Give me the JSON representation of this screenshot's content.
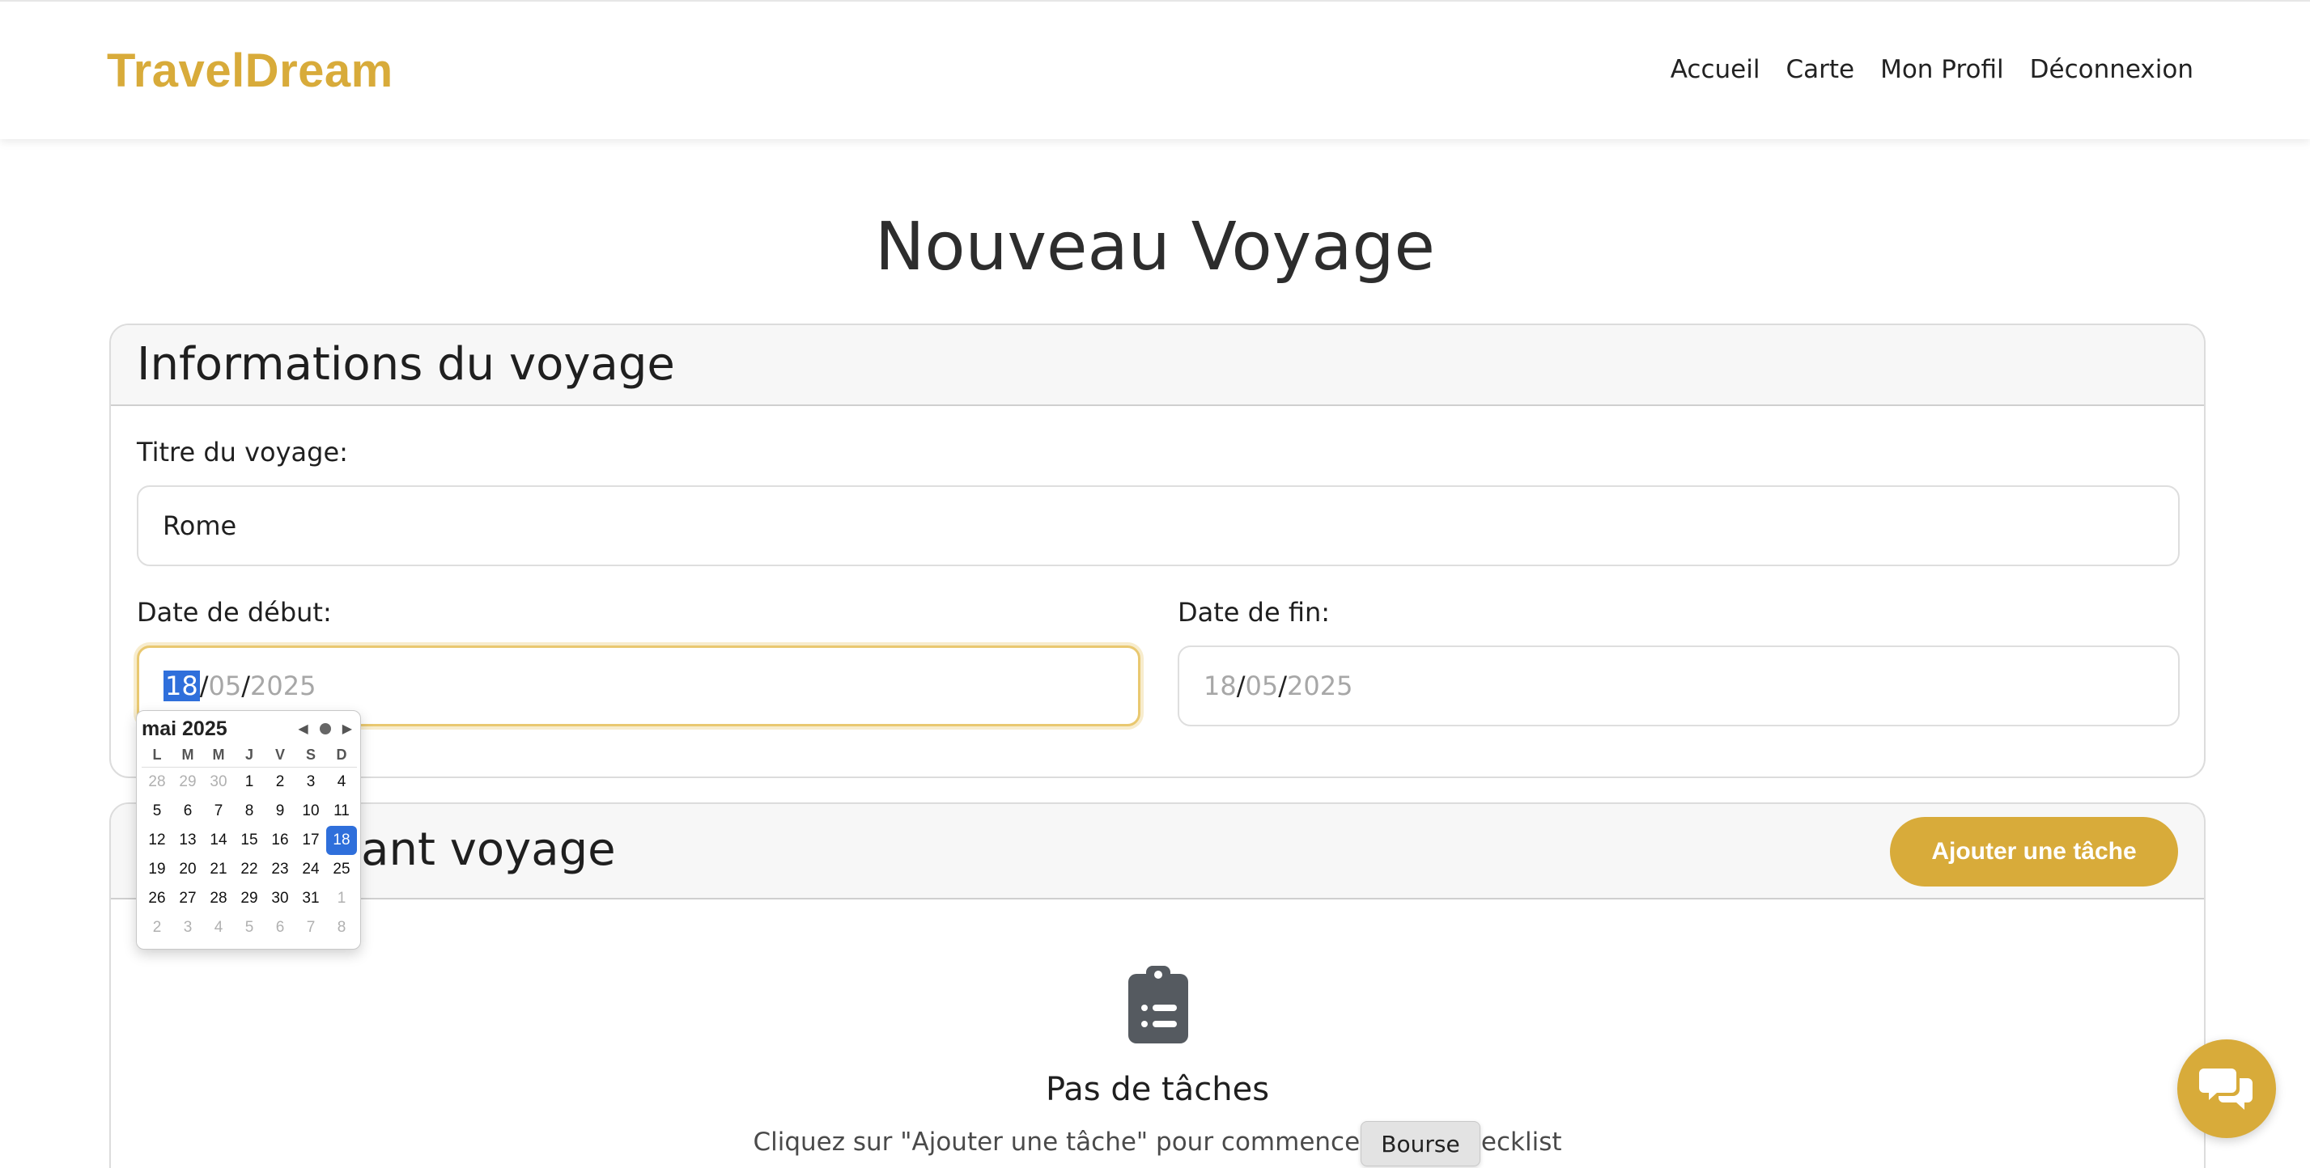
{
  "nav": {
    "brand": "TravelDream",
    "links": [
      "Accueil",
      "Carte",
      "Mon Profil",
      "Déconnexion"
    ]
  },
  "page": {
    "title": "Nouveau Voyage"
  },
  "info_card": {
    "title": "Informations du voyage",
    "trip_title_label": "Titre du voyage:",
    "trip_title_value": "Rome",
    "start_label": "Date de début:",
    "start_date": {
      "day": "18",
      "month": "05",
      "year": "2025"
    },
    "end_label": "Date de fin:",
    "end_date": {
      "day": "18",
      "month": "05",
      "year": "2025"
    }
  },
  "tasks_card": {
    "title": "Tâches avant voyage",
    "add_button": "Ajouter une tâche",
    "empty_title": "Pas de tâches",
    "empty_desc": "Cliquez sur \"Ajouter une tâche\" pour commencer votre checklist"
  },
  "calendar": {
    "month_label": "mai 2025",
    "weekdays": [
      "L",
      "M",
      "M",
      "J",
      "V",
      "S",
      "D"
    ],
    "days": [
      {
        "d": "28",
        "m": true
      },
      {
        "d": "29",
        "m": true
      },
      {
        "d": "30",
        "m": true
      },
      {
        "d": "1"
      },
      {
        "d": "2"
      },
      {
        "d": "3"
      },
      {
        "d": "4"
      },
      {
        "d": "5"
      },
      {
        "d": "6"
      },
      {
        "d": "7"
      },
      {
        "d": "8"
      },
      {
        "d": "9"
      },
      {
        "d": "10"
      },
      {
        "d": "11"
      },
      {
        "d": "12"
      },
      {
        "d": "13"
      },
      {
        "d": "14"
      },
      {
        "d": "15"
      },
      {
        "d": "16"
      },
      {
        "d": "17"
      },
      {
        "d": "18",
        "s": true
      },
      {
        "d": "19"
      },
      {
        "d": "20"
      },
      {
        "d": "21"
      },
      {
        "d": "22"
      },
      {
        "d": "23"
      },
      {
        "d": "24"
      },
      {
        "d": "25"
      },
      {
        "d": "26"
      },
      {
        "d": "27"
      },
      {
        "d": "28"
      },
      {
        "d": "29"
      },
      {
        "d": "30"
      },
      {
        "d": "31"
      },
      {
        "d": "1",
        "m": true
      },
      {
        "d": "2",
        "m": true
      },
      {
        "d": "3",
        "m": true
      },
      {
        "d": "4",
        "m": true
      },
      {
        "d": "5",
        "m": true
      },
      {
        "d": "6",
        "m": true
      },
      {
        "d": "7",
        "m": true
      },
      {
        "d": "8",
        "m": true
      }
    ]
  },
  "tooltip": "Bourse",
  "colors": {
    "accent": "#d8ab3a",
    "selection": "#2f6fdb"
  },
  "icons": {
    "empty": "clipboard-list-icon",
    "chat": "chat-bubbles-icon"
  }
}
